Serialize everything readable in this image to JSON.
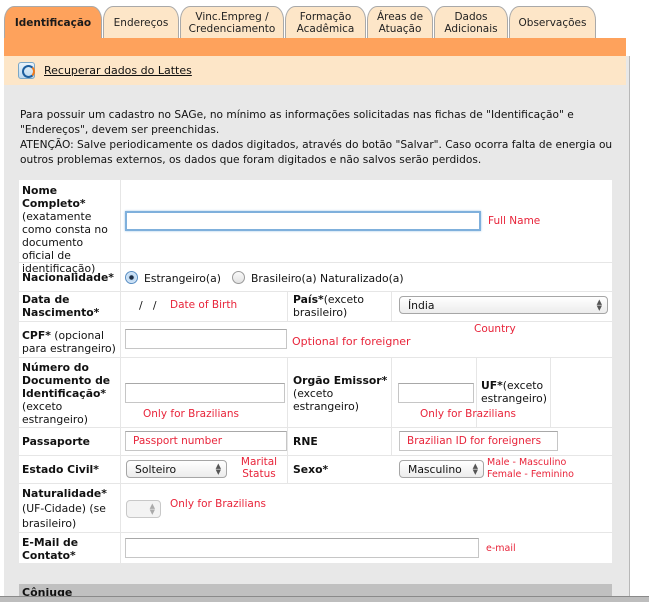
{
  "tabs": [
    {
      "label": "Identificação",
      "active": true
    },
    {
      "label": "Endereços",
      "active": false
    },
    {
      "label": "Vinc.Empreg / Credenciamento",
      "active": false
    },
    {
      "label": "Formação Acadêmica",
      "active": false
    },
    {
      "label": "Áreas de Atuação",
      "active": false
    },
    {
      "label": "Dados Adicionais",
      "active": false
    },
    {
      "label": "Observações",
      "active": false
    }
  ],
  "lattes": {
    "icon": "lattes-logo-icon",
    "link_label": "Recuperar dados do Lattes"
  },
  "intro": {
    "line1": "Para possuir um cadastro no SAGe, no mínimo as informações solicitadas nas fichas de \"Identificação\" e \"Endereços\", devem ser preenchidas.",
    "line2": "ATENÇÃO: Salve periodicamente os dados digitados, através do botão \"Salvar\". Caso ocorra falta de energia ou outros problemas externos, os dados que foram digitados e não salvos serão perdidos."
  },
  "form": {
    "nome": {
      "label": "Nome Completo*",
      "sub": "(exatamente como consta no documento oficial de identificação)",
      "value": "",
      "hint": "Full Name"
    },
    "nacionalidade": {
      "label": "Nacionalidade*",
      "options": [
        {
          "label": "Estrangeiro(a)",
          "checked": true
        },
        {
          "label": "Brasileiro(a) Naturalizado(a)",
          "checked": false
        }
      ]
    },
    "nascimento": {
      "label": "Data de Nascimento*",
      "value": "/   /",
      "hint": "Date of Birth"
    },
    "pais": {
      "label": "País*",
      "sub": "(exceto brasileiro)",
      "selected": "Índia",
      "hint": "Country"
    },
    "cpf": {
      "label": "CPF*",
      "sub": "(opcional para estrangeiro)",
      "value": "",
      "hint": "Optional for foreigner"
    },
    "documento": {
      "label": "Número do Documento de Identificação*",
      "sub": "(exceto estrangeiro)",
      "value": "",
      "hint": "Only for Brazilians"
    },
    "orgao": {
      "label": "Orgão Emissor*",
      "sub": "(exceto estrangeiro)",
      "value": ""
    },
    "uf": {
      "label": "UF*",
      "sub": "(exceto estrangeiro)",
      "hint": "Only for Brazilians"
    },
    "passaporte": {
      "label": "Passaporte",
      "value": "Passport number"
    },
    "rne": {
      "label": "RNE",
      "value": "Brazilian ID for foreigners"
    },
    "estado_civil": {
      "label": "Estado Civil*",
      "selected": "Solteiro",
      "hint_line1": "Marital",
      "hint_line2": "Status"
    },
    "sexo": {
      "label": "Sexo*",
      "selected": "Masculino",
      "hint_line1": "Male - Masculino",
      "hint_line2": "Female - Feminino"
    },
    "naturalidade": {
      "label": "Naturalidade*",
      "sub": "(UF-Cidade) (se brasileiro)",
      "selected": "",
      "hint": "Only for Brazilians"
    },
    "email": {
      "label": "E-Mail de Contato*",
      "value": "",
      "hint": "e-mail"
    }
  },
  "sections": {
    "conjuge": "Cônjuge"
  },
  "colors": {
    "accent_orange": "#fea25c",
    "tab_inactive": "#fde6c8",
    "hint_red": "#e8243a",
    "panel_gray": "#e8e8e8"
  }
}
